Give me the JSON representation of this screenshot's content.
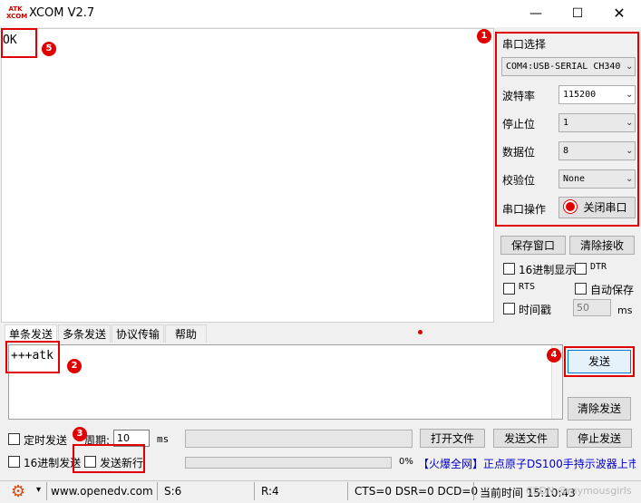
{
  "window": {
    "app_icon_text": "ATK XCOM",
    "title": "XCOM V2.7",
    "controls": [
      "minimize-icon",
      "maximize-icon",
      "close-icon"
    ]
  },
  "receive": {
    "text": "OK"
  },
  "serial_panel": {
    "heading": "串口选择",
    "port_value": "COM4:USB-SERIAL CH340",
    "baud_label": "波特率",
    "baud_value": "115200",
    "stop_label": "停止位",
    "stop_value": "1",
    "data_label": "数据位",
    "data_value": "8",
    "parity_label": "校验位",
    "parity_value": "None",
    "op_label": "串口操作",
    "op_button": "关闭串口"
  },
  "right_options": {
    "save_window": "保存窗口",
    "clear_receive": "清除接收",
    "hex_display": "16进制显示",
    "dtr": "DTR",
    "rts": "RTS",
    "auto_save": "自动保存",
    "timestamp": "时间戳",
    "timestamp_value": "50",
    "timestamp_unit": "ms"
  },
  "tabs": [
    "单条发送",
    "多条发送",
    "协议传输",
    "帮助"
  ],
  "send": {
    "text": "+++atk",
    "send_button": "发送",
    "clear_send": "清除发送"
  },
  "bottom": {
    "timed_send": "定时发送",
    "period_label": "周期:",
    "period_value": "10",
    "period_unit": "ms",
    "open_file": "打开文件",
    "send_file": "发送文件",
    "stop_send": "停止发送",
    "hex_send": "16进制发送",
    "send_newline": "发送新行",
    "progress_text": "0%",
    "progress": 0,
    "ad_text": "【火爆全网】正点原子DS100手持示波器上市"
  },
  "badges": [
    "1",
    "2",
    "3",
    "4",
    "5"
  ],
  "status": {
    "url": "www.openedv.com",
    "s": "S:6",
    "r": "R:4",
    "lines": "CTS=0 DSR=0 DCD=0",
    "time": "当前时间 15:10:43",
    "watermark": "CSDN @mymousgirls"
  },
  "colors": {
    "highlight": "#e00000",
    "link_blue": "#0000cc",
    "selected_blue": "#cce4f7"
  }
}
